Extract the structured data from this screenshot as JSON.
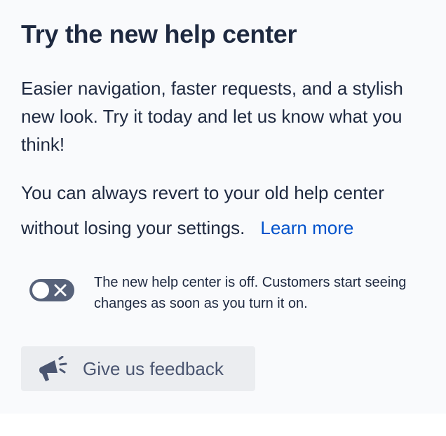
{
  "title": "Try the new help center",
  "intro": "Easier navigation, faster requests, and a stylish new look. Try it today and let us know what you think!",
  "revert_text": "You can always revert to your old help center without losing your settings.",
  "learn_more_label": "Learn more",
  "toggle": {
    "state": "off",
    "description": "The new help center is off. Customers start seeing changes as soon as you turn it on."
  },
  "feedback_button": {
    "label": "Give us feedback",
    "icon": "megaphone-icon"
  },
  "colors": {
    "text": "#1e2940",
    "link": "#0052cc",
    "toggle_off": "#57627a",
    "button_bg": "#ebedf0",
    "panel_bg": "#f9fafc"
  }
}
